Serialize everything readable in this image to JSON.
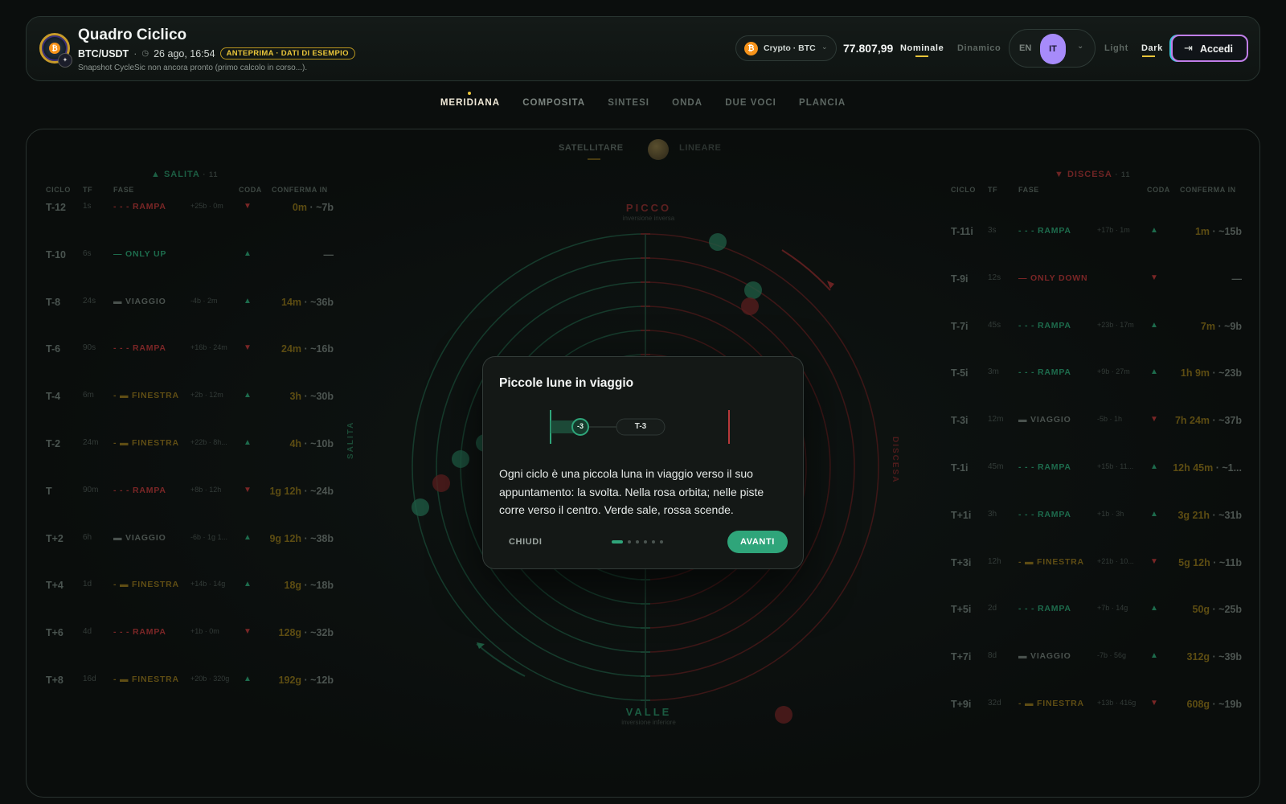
{
  "header": {
    "title": "Quadro Ciclico",
    "pair": "BTC/USDT",
    "datetime": "26 ago, 16:54",
    "preview_badge": "ANTEPRIMA · DATI DI ESEMPIO",
    "snapshot_note": "Snapshot CycleSic non ancora pronto (primo calcolo in corso...).",
    "market_selector": "Crypto · BTC",
    "price": "77.807,99",
    "mode_nominal": "Nominale",
    "mode_dynamic": "Dinamico",
    "lang_en": "EN",
    "lang_it": "IT",
    "theme_light": "Light",
    "theme_dark": "Dark",
    "login_label": "Accedi"
  },
  "nav": {
    "tabs": [
      "MERIDIANA",
      "COMPOSITA",
      "SINTESI",
      "ONDA",
      "DUE VOCI",
      "PLANCIA"
    ],
    "active": "MERIDIANA"
  },
  "view_toggle": {
    "satellite": "SATELLITARE",
    "linear": "LINEARE"
  },
  "left_table": {
    "title": "▲ SALITA",
    "count": "· 11",
    "columns": [
      "CICLO",
      "TF",
      "FASE",
      "CODA",
      "CONFERMA IN"
    ],
    "rows": [
      {
        "cycle": "T-12",
        "tf": "1s",
        "phase": "RAMPA",
        "meta": "+25b · 0m",
        "dir": "down",
        "conf_a": "0m",
        "conf_b": " · ~7b"
      },
      {
        "cycle": "T-10",
        "tf": "6s",
        "phase": "ONLY UP",
        "meta": "",
        "dir": "up",
        "conf_a": "",
        "conf_b": "—"
      },
      {
        "cycle": "T-8",
        "tf": "24s",
        "phase": "VIAGGIO",
        "meta": "-4b · 2m",
        "dir": "up",
        "conf_a": "14m",
        "conf_b": " · ~36b"
      },
      {
        "cycle": "T-6",
        "tf": "90s",
        "phase": "RAMPA",
        "meta": "+16b · 24m",
        "dir": "down",
        "conf_a": "24m",
        "conf_b": " · ~16b"
      },
      {
        "cycle": "T-4",
        "tf": "6m",
        "phase": "FINESTRA",
        "meta": "+2b · 12m",
        "dir": "up",
        "conf_a": "3h",
        "conf_b": " · ~30b"
      },
      {
        "cycle": "T-2",
        "tf": "24m",
        "phase": "FINESTRA",
        "meta": "+22b · 8h...",
        "dir": "up",
        "conf_a": "4h",
        "conf_b": " · ~10b"
      },
      {
        "cycle": "T",
        "tf": "90m",
        "phase": "RAMPA",
        "meta": "+8b · 12h",
        "dir": "down",
        "conf_a": "1g 12h",
        "conf_b": " · ~24b"
      },
      {
        "cycle": "T+2",
        "tf": "6h",
        "phase": "VIAGGIO",
        "meta": "-6b · 1g 1...",
        "dir": "up",
        "conf_a": "9g 12h",
        "conf_b": " · ~38b"
      },
      {
        "cycle": "T+4",
        "tf": "1d",
        "phase": "FINESTRA",
        "meta": "+14b · 14g",
        "dir": "up",
        "conf_a": "18g",
        "conf_b": " · ~18b"
      },
      {
        "cycle": "T+6",
        "tf": "4d",
        "phase": "RAMPA",
        "meta": "+1b · 0m",
        "dir": "down",
        "conf_a": "128g",
        "conf_b": " · ~32b"
      },
      {
        "cycle": "T+8",
        "tf": "16d",
        "phase": "FINESTRA",
        "meta": "+20b · 320g",
        "dir": "up",
        "conf_a": "192g",
        "conf_b": " · ~12b"
      }
    ]
  },
  "right_table": {
    "title": "▼ DISCESA",
    "count": "· 11",
    "columns": [
      "CICLO",
      "TF",
      "FASE",
      "CODA",
      "CONFERMA IN"
    ],
    "rows": [
      {
        "cycle": "T-11i",
        "tf": "3s",
        "phase": "RAMPA",
        "meta": "+17b · 1m",
        "dir": "up",
        "conf_a": "1m",
        "conf_b": " · ~15b"
      },
      {
        "cycle": "T-9i",
        "tf": "12s",
        "phase": "ONLY DOWN",
        "meta": "",
        "dir": "down",
        "conf_a": "",
        "conf_b": "—"
      },
      {
        "cycle": "T-7i",
        "tf": "45s",
        "phase": "RAMPA",
        "meta": "+23b · 17m",
        "dir": "up",
        "conf_a": "7m",
        "conf_b": " · ~9b"
      },
      {
        "cycle": "T-5i",
        "tf": "3m",
        "phase": "RAMPA",
        "meta": "+9b · 27m",
        "dir": "up",
        "conf_a": "1h 9m",
        "conf_b": " · ~23b"
      },
      {
        "cycle": "T-3i",
        "tf": "12m",
        "phase": "VIAGGIO",
        "meta": "-5b · 1h",
        "dir": "down",
        "conf_a": "7h 24m",
        "conf_b": " · ~37b"
      },
      {
        "cycle": "T-1i",
        "tf": "45m",
        "phase": "RAMPA",
        "meta": "+15b · 11...",
        "dir": "up",
        "conf_a": "12h 45m",
        "conf_b": " · ~1..."
      },
      {
        "cycle": "T+1i",
        "tf": "3h",
        "phase": "RAMPA",
        "meta": "+1b · 3h",
        "dir": "up",
        "conf_a": "3g 21h",
        "conf_b": " · ~31b"
      },
      {
        "cycle": "T+3i",
        "tf": "12h",
        "phase": "FINESTRA",
        "meta": "+21b · 10...",
        "dir": "down",
        "conf_a": "5g 12h",
        "conf_b": " · ~11b"
      },
      {
        "cycle": "T+5i",
        "tf": "2d",
        "phase": "RAMPA",
        "meta": "+7b · 14g",
        "dir": "up",
        "conf_a": "50g",
        "conf_b": " · ~25b"
      },
      {
        "cycle": "T+7i",
        "tf": "8d",
        "phase": "VIAGGIO",
        "meta": "-7b · 56g",
        "dir": "up",
        "conf_a": "312g",
        "conf_b": " · ~39b"
      },
      {
        "cycle": "T+9i",
        "tf": "32d",
        "phase": "FINESTRA",
        "meta": "+13b · 416g",
        "dir": "down",
        "conf_a": "608g",
        "conf_b": " · ~19b"
      }
    ]
  },
  "dial": {
    "top_label": "PICCO",
    "top_sub": "inversione inversa",
    "bottom_label": "VALLE",
    "bottom_sub": "inversione inferiore",
    "left_label": "SALITA",
    "right_label": "DISCESA"
  },
  "modal": {
    "title": "Piccole lune in viaggio",
    "moon_label": "-3",
    "cycle_tag": "T-3",
    "body": "Ogni ciclo è una piccola luna in viaggio verso il suo appuntamento: la svolta. Nella rosa orbita; nelle piste corre verso il centro. Verde sale, rossa scende.",
    "close_label": "CHIUDI",
    "next_label": "AVANTI",
    "step": 1,
    "steps_total": 6
  },
  "colors": {
    "accent_green": "#2fa57a",
    "accent_red": "#b8393a",
    "accent_gold": "#e9c53a",
    "accent_purple": "#a78bfa"
  }
}
